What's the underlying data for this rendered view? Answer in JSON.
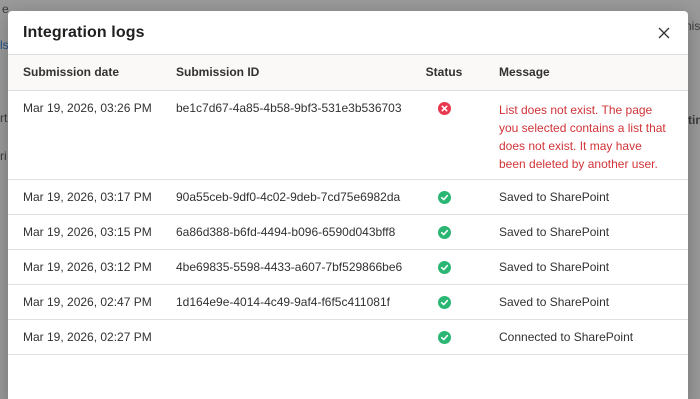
{
  "dialog": {
    "title": "Integration logs",
    "close_label": "×"
  },
  "columns": {
    "date": "Submission date",
    "id": "Submission ID",
    "status": "Status",
    "message": "Message"
  },
  "rows": [
    {
      "date": "Mar 19, 2026, 03:26 PM",
      "id": "be1c7d67-4a85-4b58-9bf3-531e3b536703",
      "status": "error",
      "message": "List does not exist. The page you selected contains a list that does not exist. It may have been deleted by another user."
    },
    {
      "date": "Mar 19, 2026, 03:17 PM",
      "id": "90a55ceb-9df0-4c02-9deb-7cd75e6982da",
      "status": "success",
      "message": "Saved to SharePoint"
    },
    {
      "date": "Mar 19, 2026, 03:15 PM",
      "id": "6a86d388-b6fd-4494-b096-6590d043bff8",
      "status": "success",
      "message": "Saved to SharePoint"
    },
    {
      "date": "Mar 19, 2026, 03:12 PM",
      "id": "4be69835-5598-4433-a607-7bf529866be6",
      "status": "success",
      "message": "Saved to SharePoint"
    },
    {
      "date": "Mar 19, 2026, 02:47 PM",
      "id": "1d164e9e-4014-4c49-9af4-f6f5c411081f",
      "status": "success",
      "message": "Saved to SharePoint"
    },
    {
      "date": "Mar 19, 2026, 02:27 PM",
      "id": "",
      "status": "success",
      "message": "Connected to SharePoint"
    }
  ],
  "status_icons": {
    "error": "error-circle-icon",
    "success": "checkmark-circle-icon"
  },
  "colors": {
    "error": "#e8384f",
    "success": "#2bb673",
    "error_text": "#d13438"
  },
  "background_fragments": [
    "e",
    "ls",
    "rts",
    "ri",
    "nis",
    "tin"
  ]
}
